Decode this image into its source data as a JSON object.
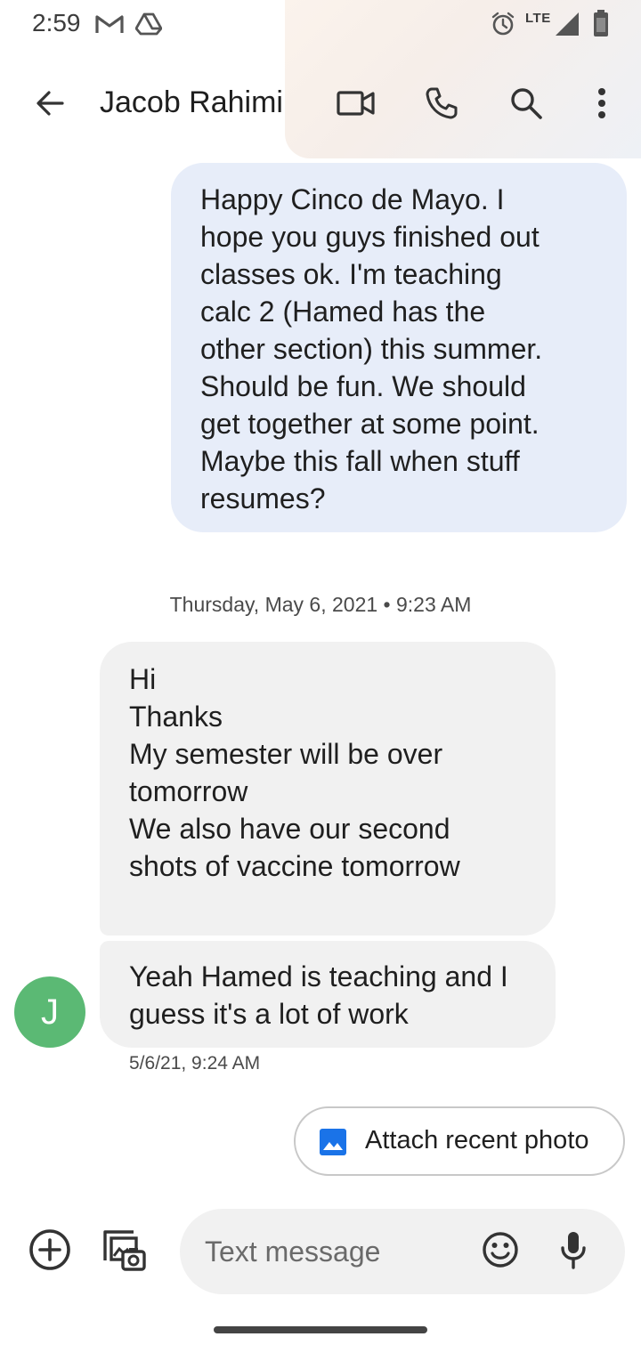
{
  "status_bar": {
    "time": "2:59",
    "network": "LTE",
    "icons": [
      "gmail-icon",
      "drive-icon",
      "alarm-icon",
      "signal-icon",
      "battery-icon"
    ]
  },
  "header": {
    "contact_name": "Jacob Rahimi",
    "icons": [
      "back-arrow-icon",
      "video-call-icon",
      "phone-icon",
      "search-icon",
      "more-vert-icon"
    ]
  },
  "messages": [
    {
      "direction": "outgoing",
      "text": "Happy Cinco de Mayo. I\nhope you guys finished out\nclasses ok. I'm teaching\ncalc 2 (Hamed has the\nother section) this summer.\nShould be fun. We should\nget together at some point.\nMaybe this fall when stuff\nresumes?"
    },
    {
      "direction": "incoming",
      "text": "Hi\nThanks\nMy semester will be over\ntomorrow\nWe also have our second\nshots of vaccine tomorrow"
    },
    {
      "direction": "incoming",
      "text": "Yeah Hamed is teaching and I\nguess it's a lot of work"
    }
  ],
  "date_divider": "Thursday, May 6, 2021 • 9:23 AM",
  "avatar_initial": "J",
  "message_timestamp": "5/6/21, 9:24 AM",
  "attach_chip": {
    "label": "Attach recent photo",
    "icon": "image-icon"
  },
  "compose": {
    "placeholder": "Text message",
    "value": "",
    "icons": [
      "add-icon",
      "gallery-camera-icon",
      "emoji-icon",
      "mic-icon"
    ]
  },
  "colors": {
    "outgoing_bubble": "#e7edf9",
    "incoming_bubble": "#f1f1f1",
    "avatar": "#5bb974",
    "accent": "#1a73e8"
  }
}
